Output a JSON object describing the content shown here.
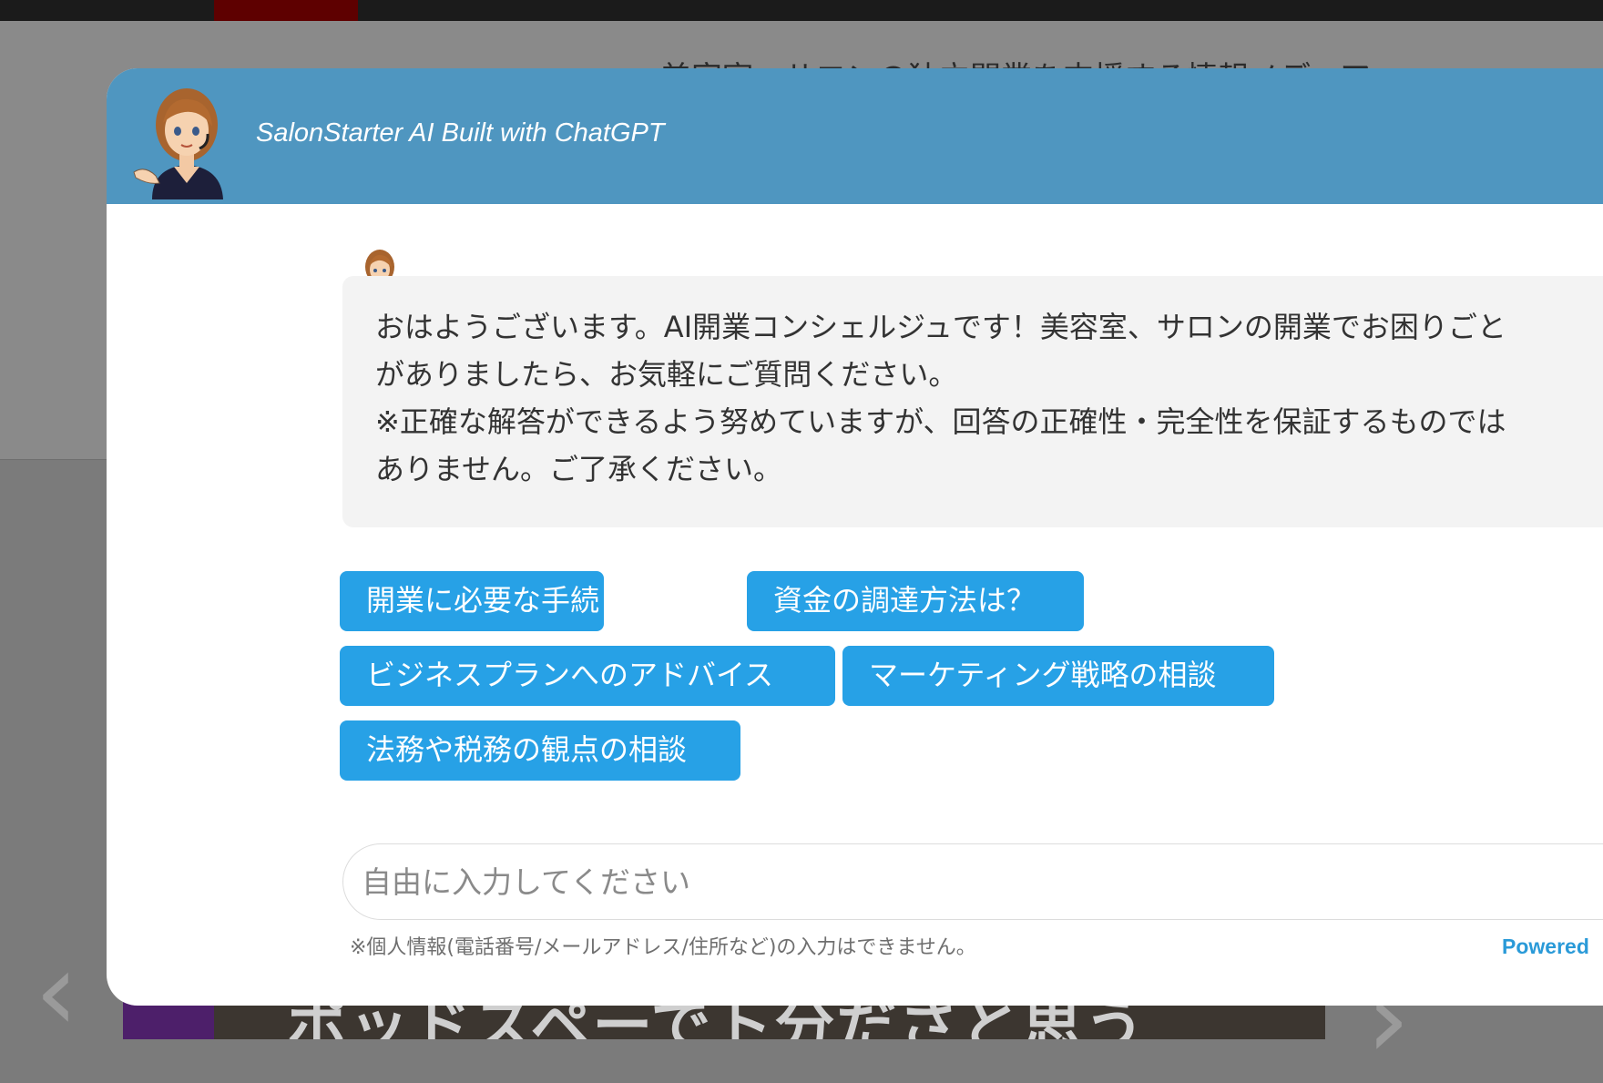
{
  "background_page": {
    "tagline": "美容室、サロンの独立開業を支援する情報メディア",
    "hero_text": "ポッドスペーでト分ださと思う"
  },
  "chat": {
    "title": "SalonStarter AI Built with ChatGPT",
    "greeting_lines": [
      "おはようございます。AI開業コンシェルジュです！美容室、サロンの開業でお困りごと",
      "がありましたら、お気軽にご質問ください。",
      "※正確な解答ができるよう努めていますが、回答の正確性・完全性を保証するものでは",
      "ありません。ご了承ください。"
    ],
    "suggestions": [
      "開業に必要な手続きは？",
      "資金の調達方法は？",
      "ビジネスプランへのアドバイス",
      "マーケティング戦略の相談",
      "法務や税務の観点の相談"
    ],
    "input_placeholder": "自由に入力してください",
    "privacy_note": "※個人情報(電話番号/メールアドレス/住所など)の入力はできません。",
    "powered_by": "Powered",
    "colors": {
      "header": "#4f96c0",
      "suggestion": "#27a1e6",
      "powered_link": "#2a9ad8"
    },
    "icons": [
      "assistant-avatar-icon"
    ]
  }
}
